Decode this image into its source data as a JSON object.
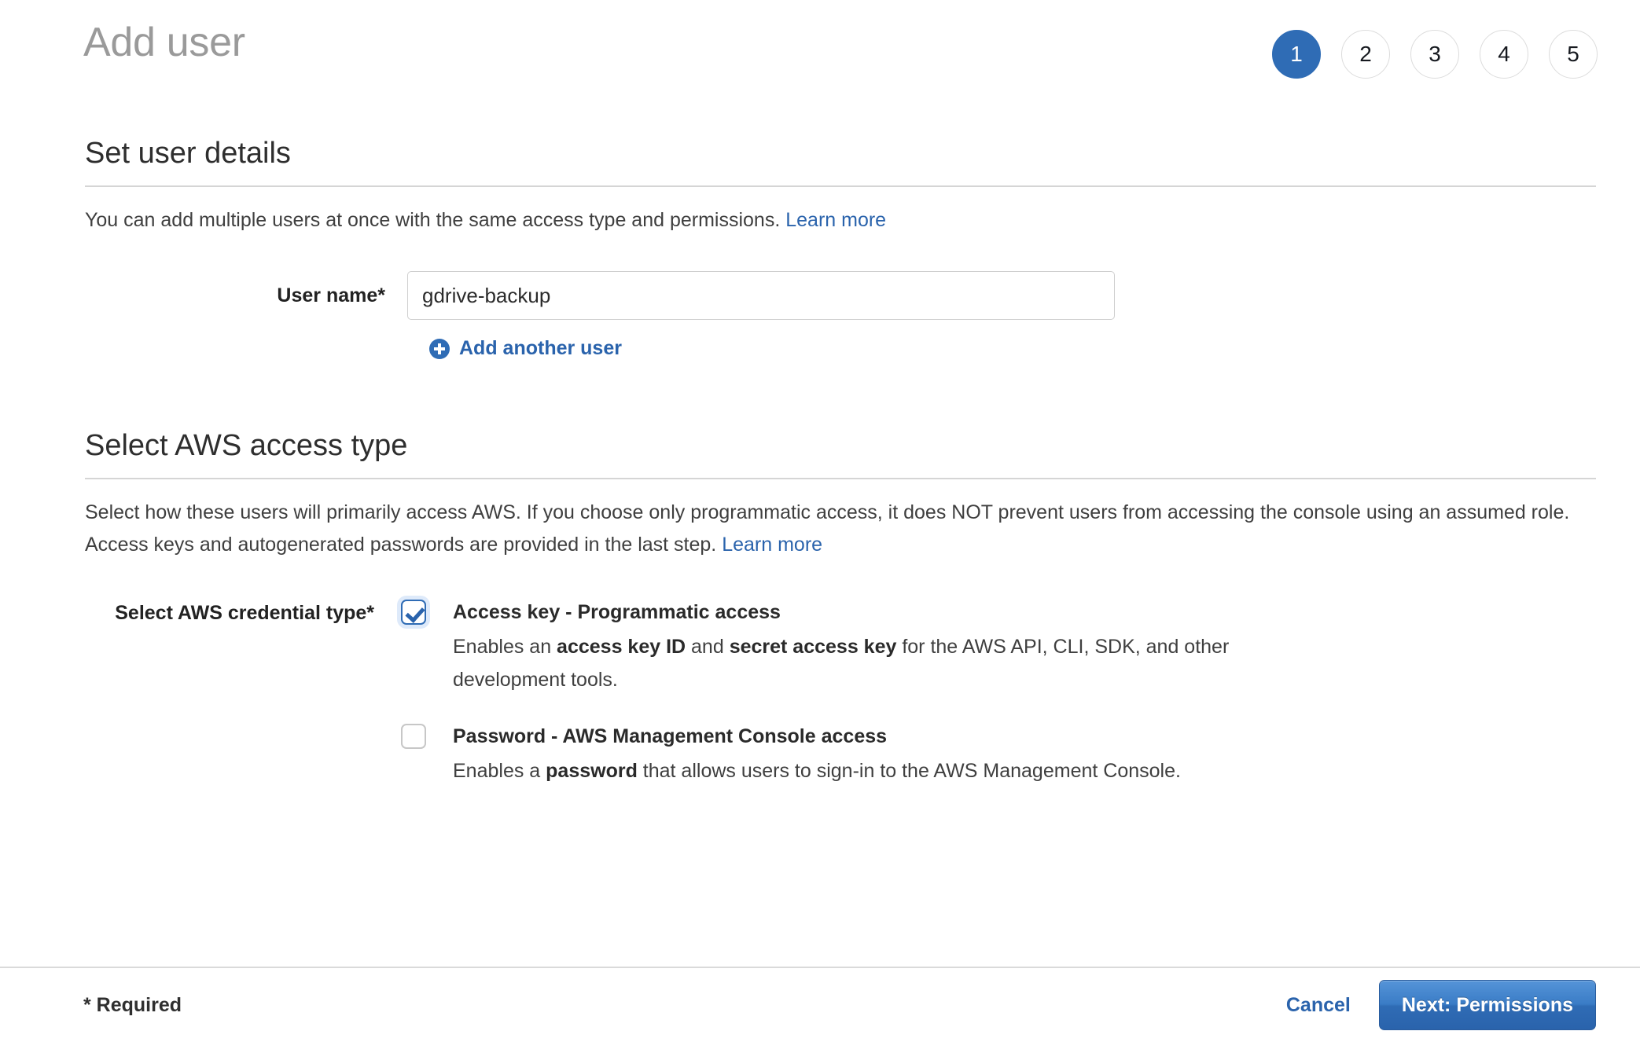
{
  "header": {
    "title": "Add user",
    "steps": [
      {
        "label": "1",
        "active": true
      },
      {
        "label": "2",
        "active": false
      },
      {
        "label": "3",
        "active": false
      },
      {
        "label": "4",
        "active": false
      },
      {
        "label": "5",
        "active": false
      }
    ]
  },
  "details_section": {
    "heading": "Set user details",
    "description": "You can add multiple users at once with the same access type and permissions.",
    "learn_more": "Learn more",
    "user_name_label": "User name*",
    "user_name_value": "gdrive-backup",
    "user_name_placeholder": "",
    "add_another_label": "Add another user"
  },
  "access_section": {
    "heading": "Select AWS access type",
    "description": "Select how these users will primarily access AWS. If you choose only programmatic access, it does NOT prevent users from accessing the console using an assumed role. Access keys and autogenerated passwords are provided in the last step.",
    "learn_more": "Learn more",
    "credential_label": "Select AWS credential type*",
    "options": [
      {
        "checked": true,
        "title": "Access key - Programmatic access",
        "desc_part1": "Enables an ",
        "desc_bold1": "access key ID",
        "desc_part2": " and ",
        "desc_bold2": "secret access key",
        "desc_part3": " for the AWS API, CLI, SDK, and other development tools."
      },
      {
        "checked": false,
        "title": "Password - AWS Management Console access",
        "desc_part1": "Enables a ",
        "desc_bold1": "password",
        "desc_part2": " that allows users to sign-in to the AWS Management Console.",
        "desc_bold2": "",
        "desc_part3": ""
      }
    ]
  },
  "footer": {
    "required_note": "* Required",
    "cancel_label": "Cancel",
    "next_label": "Next: Permissions"
  },
  "colors": {
    "accent_blue": "#2f6cb5",
    "link_blue": "#2a63ac",
    "title_gray": "#9a9a9a",
    "rule_gray": "#d5d5d5",
    "border_gray": "#cfcfcf"
  }
}
